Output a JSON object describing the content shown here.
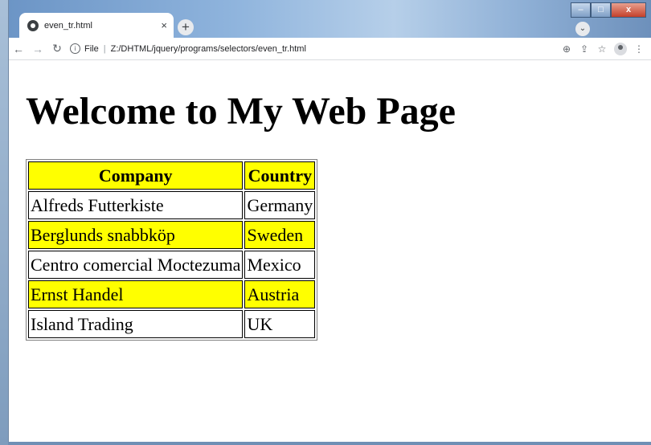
{
  "browser": {
    "tab_title": "even_tr.html",
    "tab_close": "×",
    "new_tab": "+",
    "url_scheme_label": "File",
    "url": "Z:/DHTML/jquery/programs/selectors/even_tr.html"
  },
  "page": {
    "heading": "Welcome to My Web Page",
    "highlight_color": "#ffff00",
    "table": {
      "headers": [
        "Company",
        "Country"
      ],
      "rows": [
        [
          "Alfreds Futterkiste",
          "Germany"
        ],
        [
          "Berglunds snabbköp",
          "Sweden"
        ],
        [
          "Centro comercial Moctezuma",
          "Mexico"
        ],
        [
          "Ernst Handel",
          "Austria"
        ],
        [
          "Island Trading",
          "UK"
        ]
      ],
      "highlighted_rows": "header and even rows (2nd, 4th)"
    }
  },
  "icons": [
    "favicon-icon",
    "back-icon",
    "forward-icon",
    "reload-icon",
    "info-icon",
    "zoom-icon",
    "share-icon",
    "star-icon",
    "profile-icon",
    "menu-icon",
    "tab-search-icon"
  ]
}
